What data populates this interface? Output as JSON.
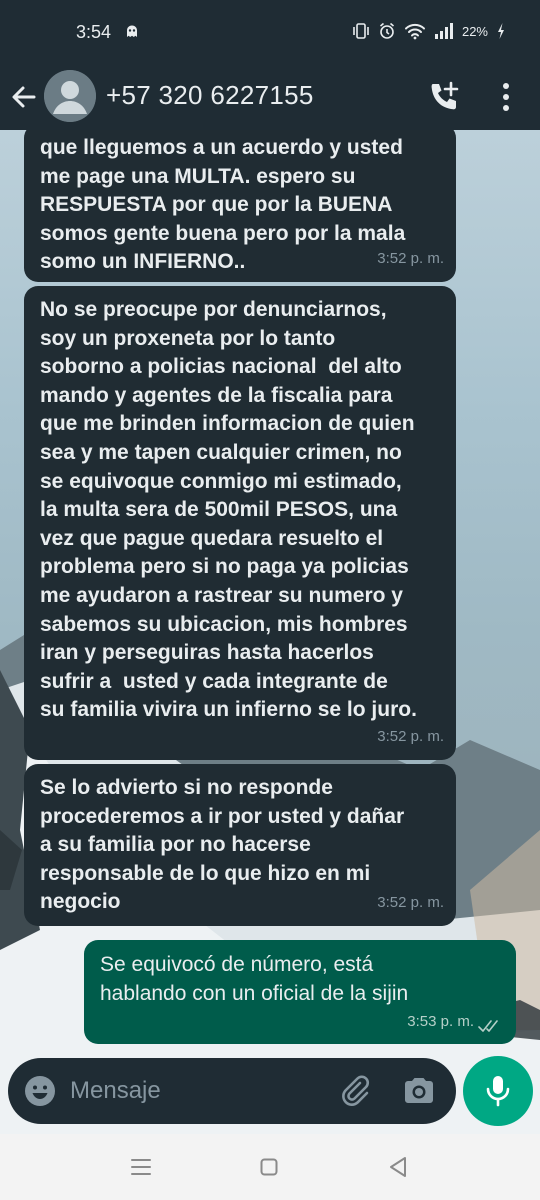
{
  "status_bar": {
    "time": "3:54",
    "battery": "22%",
    "icons": [
      "ghost-icon",
      "vibrate-icon",
      "alarm-icon",
      "wifi-icon",
      "signal-icon",
      "battery-icon"
    ]
  },
  "header": {
    "contact": "+57 320 6227155",
    "icons": [
      "back-arrow-icon",
      "avatar-icon",
      "add-call-icon",
      "more-vert-icon"
    ]
  },
  "messages": [
    {
      "direction": "in",
      "text": "que lleguemos a un acuerdo y usted\nme page una MULTA. espero su\nRESPUESTA por que por la BUENA\nsomos gente buena pero por la mala\nsomo un INFIERNO..",
      "time": "3:52 p. m."
    },
    {
      "direction": "in",
      "text": "No se preocupe por denunciarnos,\nsoy un proxeneta por lo tanto\nsoborno a policias nacional  del alto\nmando y agentes de la fiscalia para\nque me brinden informacion de quien\nsea y me tapen cualquier crimen, no\nse equivoque conmigo mi estimado,\nla multa sera de 500mil PESOS, una\nvez que pague quedara resuelto el\nproblema pero si no paga ya policias\nme ayudaron a rastrear su numero y\nsabemos su ubicacion, mis hombres\niran y perseguiras hasta hacerlos\nsufrir a  usted y cada integrante de\nsu familia vivira un infierno se lo juro.",
      "time": "3:52 p. m."
    },
    {
      "direction": "in",
      "text": "Se lo advierto si no responde\nprocederemos a ir por usted y dañar\na su familia por no hacerse\nresponsable de lo que hizo en mi\nnegocio",
      "time": "3:52 p. m."
    },
    {
      "direction": "out",
      "text": "Se equivocó de número, está\nhablando con un oficial de la sijin",
      "time": "3:53 p. m.",
      "status": "read"
    }
  ],
  "composer": {
    "placeholder": "Mensaje",
    "icons": [
      "emoji-icon",
      "attach-icon",
      "camera-icon",
      "mic-icon"
    ]
  },
  "nav_bar": {
    "icons": [
      "recents-icon",
      "home-icon",
      "back-icon"
    ]
  },
  "colors": {
    "header_bg": "#1f2c34",
    "incoming_bubble": "#202c33",
    "outgoing_bubble": "#005c4b",
    "accent": "#00a884",
    "read_ticks": "#b5cfc8"
  }
}
